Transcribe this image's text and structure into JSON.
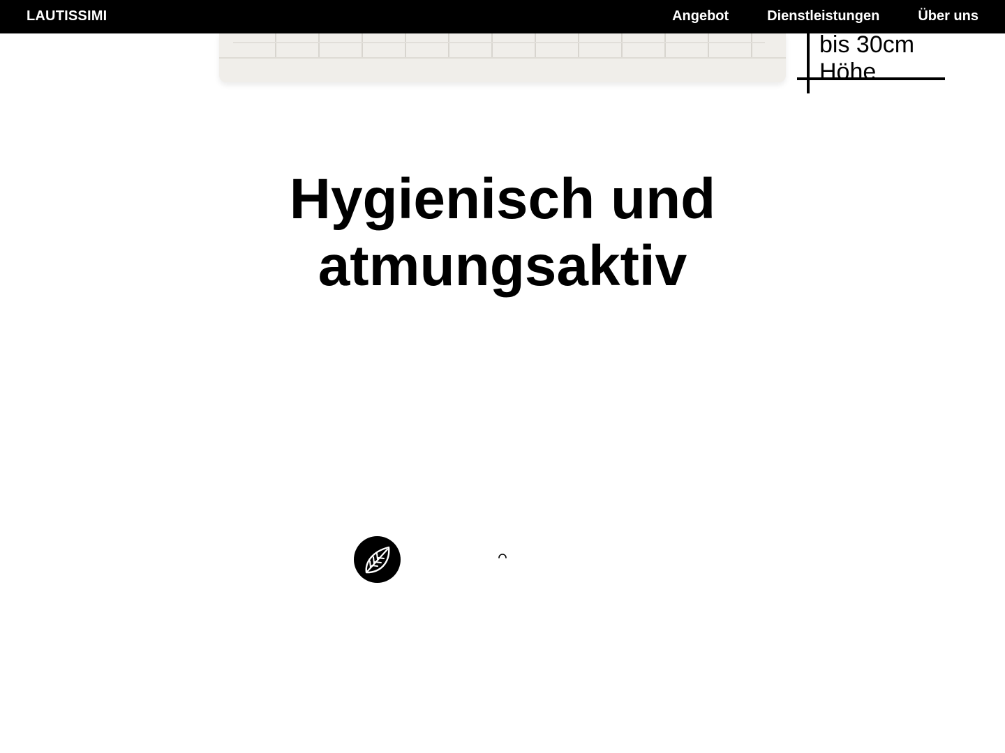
{
  "nav": {
    "brand": "LAUTISSIMI",
    "links": [
      "Angebot",
      "Dienstleistungen",
      "Über uns"
    ]
  },
  "height_note": {
    "line1": "bis 30cm",
    "line2": "Höhe"
  },
  "section": {
    "headline_line1": "Hygienisch und",
    "headline_line2": "atmungsaktiv"
  },
  "icons": {
    "badge": "leaf-icon",
    "loader": "loading-spinner-icon"
  },
  "colors": {
    "nav_background": "#000000",
    "nav_text": "#ffffff",
    "page_background": "#ffffff",
    "text": "#000000"
  }
}
